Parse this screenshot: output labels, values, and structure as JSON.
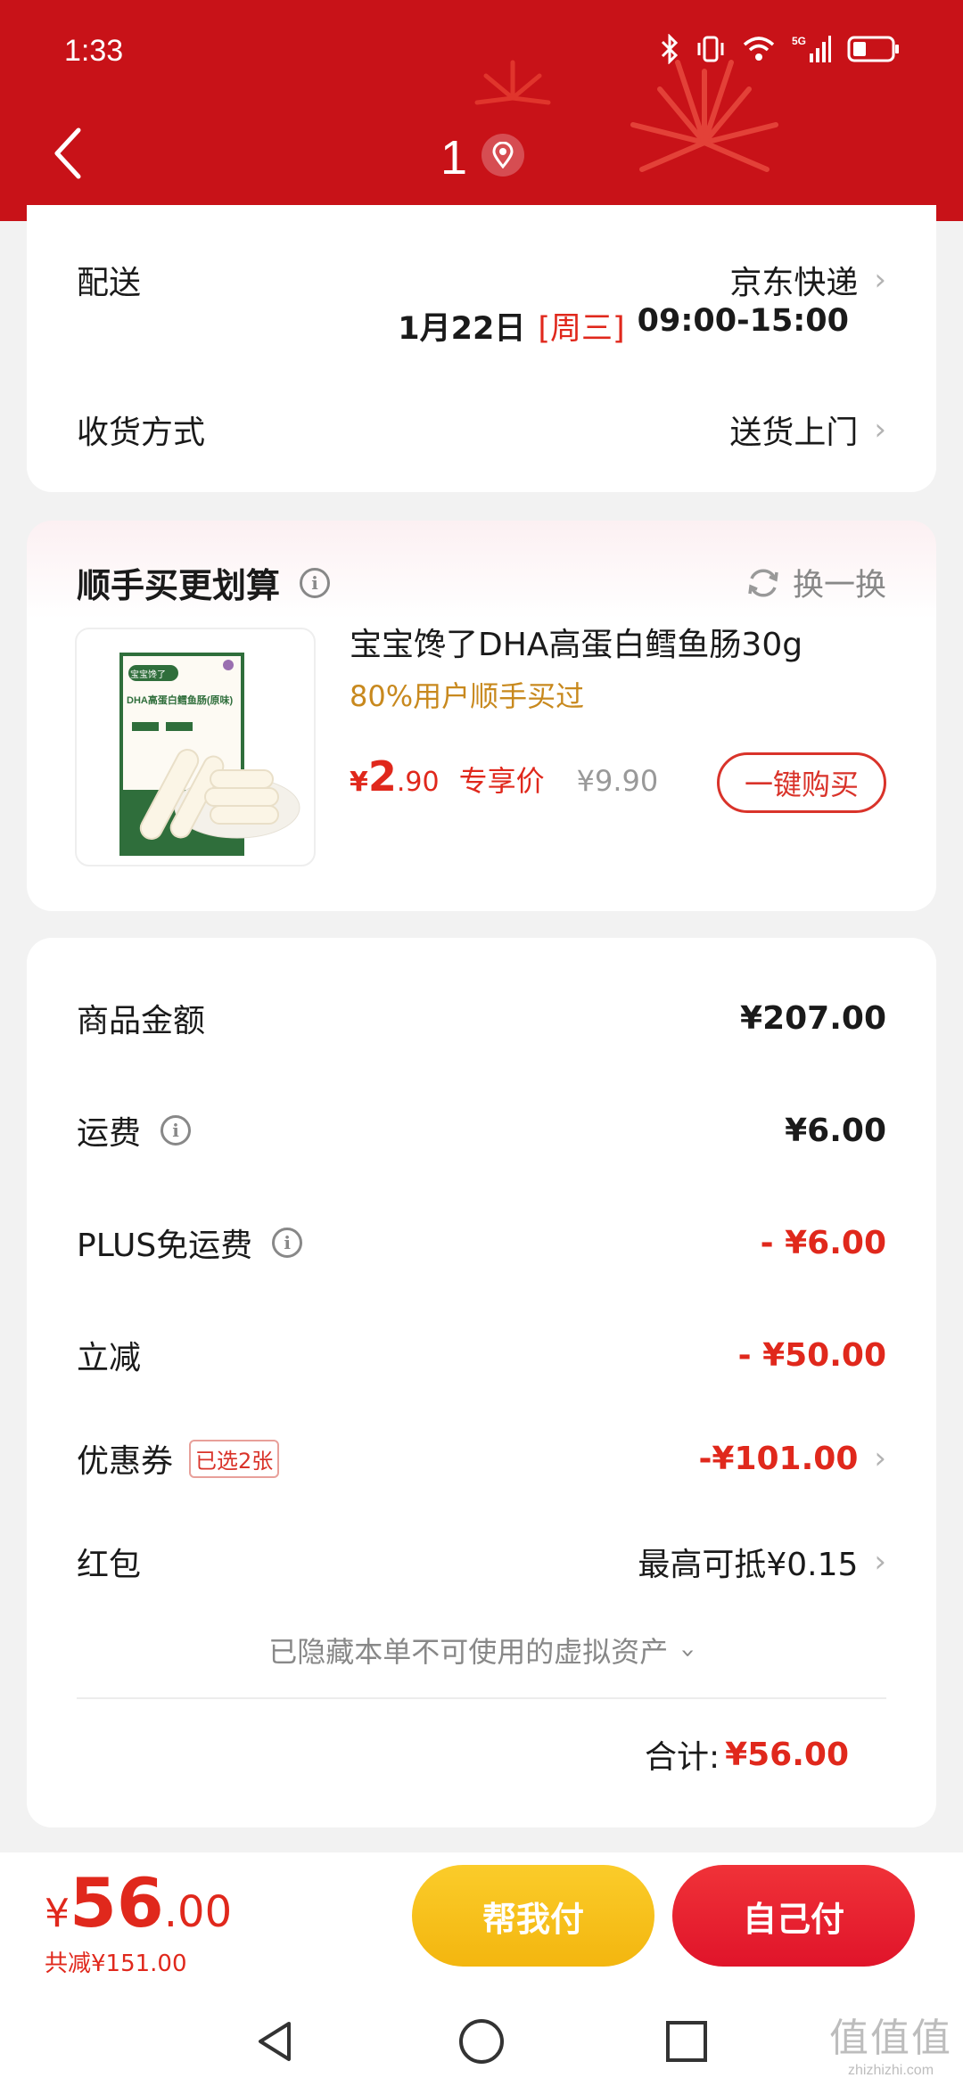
{
  "status": {
    "time": "1:33"
  },
  "header": {
    "title": "1"
  },
  "delivery": {
    "label": "配送",
    "carrier": "京东快递",
    "date": "1月22日",
    "weekday": "[周三]",
    "time_range": "09:00-15:00",
    "receive_label": "收货方式",
    "receive_value": "送货上门"
  },
  "recommend": {
    "title": "顺手买更划算",
    "refresh_label": "换一换",
    "product_name": "宝宝馋了DHA高蛋白鳕鱼肠30g",
    "social_proof": "80%用户顺手买过",
    "price_symbol": "¥",
    "price_int": "2",
    "price_dec": ".90",
    "price_tag": "专享价",
    "orig_price": "¥9.90",
    "buy_button": "一键购买",
    "image_brand": "宝宝馋了",
    "image_text": "DHA高蛋白鳕鱼肠(原味)"
  },
  "summary": {
    "rows": [
      {
        "label": "商品金额",
        "value": "¥207.00"
      },
      {
        "label": "运费",
        "value": "¥6.00"
      },
      {
        "label": "PLUS免运费",
        "value": "- ¥6.00"
      },
      {
        "label": "立减",
        "value": "- ¥50.00"
      },
      {
        "label": "优惠券",
        "badge": "已选2张",
        "value": "-¥101.00"
      },
      {
        "label": "红包",
        "value": "最高可抵¥0.15"
      }
    ],
    "hidden_note": "已隐藏本单不可使用的虚拟资产",
    "total_label": "合计:",
    "total_value": "¥56.00"
  },
  "bottom": {
    "price_symbol": "¥",
    "price_int": "56",
    "price_dec": ".00",
    "saved": "共减¥151.00",
    "help_pay": "帮我付",
    "self_pay": "自己付"
  },
  "watermark": {
    "text": "值值值",
    "url": "zhizhizhi.com"
  },
  "colors": {
    "brand_red": "#c81218",
    "accent_red": "#e0281c",
    "yellow": "#f8c21c",
    "gold": "#c8891e"
  }
}
